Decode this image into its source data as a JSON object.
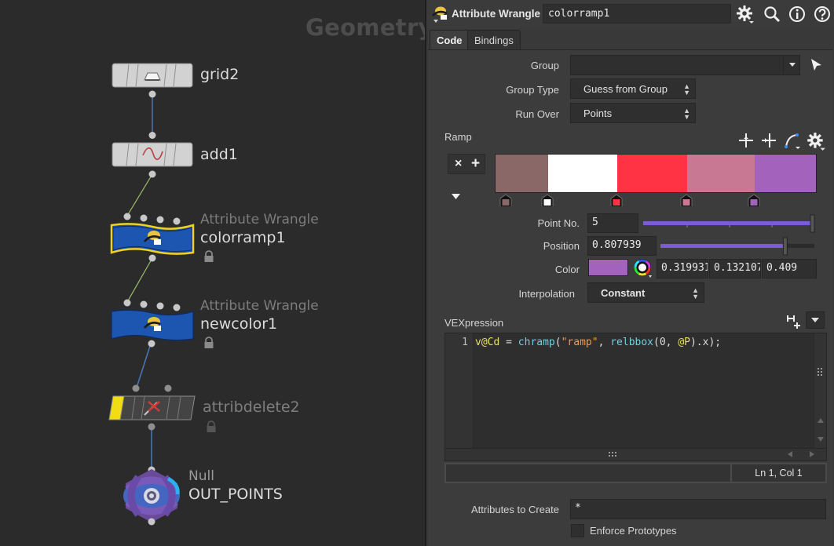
{
  "network": {
    "title": "Geometry",
    "nodes": [
      {
        "name": "grid2",
        "type": ""
      },
      {
        "name": "add1",
        "type": ""
      },
      {
        "name": "colorramp1",
        "type": "Attribute Wrangle"
      },
      {
        "name": "newcolor1",
        "type": "Attribute Wrangle"
      },
      {
        "name": "attribdelete2",
        "type": ""
      },
      {
        "name": "OUT_POINTS",
        "type": "Null"
      }
    ],
    "colors": {
      "wrangle_blue": "#1d56b0",
      "selected_outline": "#f0d020",
      "wire": "#4a78b8",
      "wire_green": "#9dbf6c",
      "bypass_yellow": "#f2dc14"
    }
  },
  "panel": {
    "node_type": "Attribute Wrangle",
    "node_name": "colorramp1",
    "header_icons": [
      "gear-icon",
      "search-icon",
      "info-icon",
      "help-icon"
    ],
    "tabs": [
      {
        "label": "Code",
        "active": true
      },
      {
        "label": "Bindings",
        "active": false
      }
    ],
    "group": {
      "label": "Group",
      "value": ""
    },
    "group_type": {
      "label": "Group Type",
      "value": "Guess from Group"
    },
    "run_over": {
      "label": "Run Over",
      "value": "Points"
    },
    "ramp": {
      "label": "Ramp",
      "remove_symbol": "×",
      "add_symbol": "+",
      "keys": [
        {
          "color": "#8a6868",
          "position": 0.0
        },
        {
          "color": "#ffffff",
          "position": 0.163
        },
        {
          "color": "#ff3344",
          "position": 0.381
        },
        {
          "color": "#c87892",
          "position": 0.598
        },
        {
          "color": "#a362bc",
          "position": 0.807939
        }
      ],
      "point_no": {
        "label": "Point No.",
        "value": "5",
        "fraction": 1.0
      },
      "position": {
        "label": "Position",
        "value": "0.807939",
        "fraction": 0.807939
      },
      "color": {
        "label": "Color",
        "swatch": "#a362bc",
        "r": "0.319931",
        "g": "0.132107",
        "b": "0.409"
      },
      "interpolation": {
        "label": "Interpolation",
        "value": "Constant"
      }
    },
    "vex": {
      "label": "VEXpression",
      "line_number": "1",
      "tokens": [
        {
          "t": "v@Cd",
          "c": "tk-var"
        },
        {
          "t": " = ",
          "c": "tk-op"
        },
        {
          "t": "chramp",
          "c": "tk-fn"
        },
        {
          "t": "(",
          "c": "tk-op"
        },
        {
          "t": "\"ramp\"",
          "c": "tk-str"
        },
        {
          "t": ", ",
          "c": "tk-op"
        },
        {
          "t": "relbbox",
          "c": "tk-fn"
        },
        {
          "t": "(0, ",
          "c": "tk-num"
        },
        {
          "t": "@P",
          "c": "tk-var"
        },
        {
          "t": ").x);",
          "c": "tk-op"
        }
      ],
      "cursor_status": "Ln 1, Col 1"
    },
    "attributes_to_create": {
      "label": "Attributes to Create",
      "value": "*"
    },
    "enforce_prototypes": {
      "label": "Enforce Prototypes",
      "checked": false
    }
  }
}
